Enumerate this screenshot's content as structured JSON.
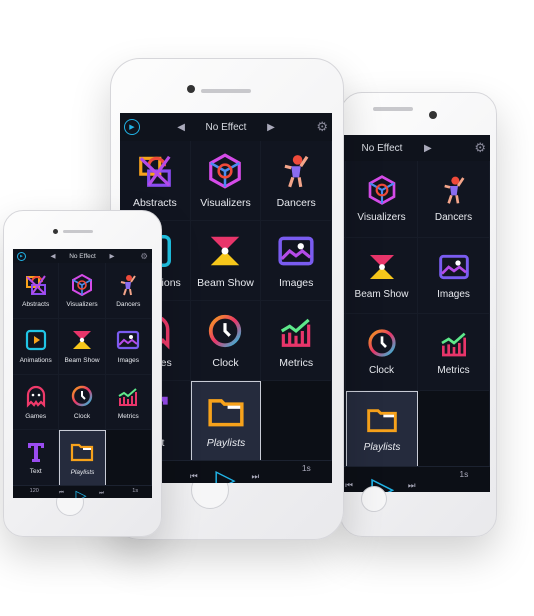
{
  "app": {
    "header": {
      "effect_label": "No Effect",
      "prev_icon": "triangle-left-icon",
      "next_icon": "triangle-right-icon",
      "settings_icon": "gear-icon",
      "logo_icon": "play-circle-logo-icon"
    },
    "categories": [
      {
        "label": "Abstracts",
        "icon": "abstract-shapes-icon"
      },
      {
        "label": "Visualizers",
        "icon": "cube-icon"
      },
      {
        "label": "Dancers",
        "icon": "dancer-icon"
      },
      {
        "label": "Animations",
        "icon": "play-square-icon"
      },
      {
        "label": "Beam Show",
        "icon": "beam-icon"
      },
      {
        "label": "Images",
        "icon": "image-icon"
      },
      {
        "label": "Games",
        "icon": "ghost-icon"
      },
      {
        "label": "Clock",
        "icon": "clock-icon"
      },
      {
        "label": "Metrics",
        "icon": "chart-icon"
      },
      {
        "label": "Text",
        "icon": "text-t-icon"
      },
      {
        "label": "Playlists",
        "icon": "folder-icon",
        "selected": true
      }
    ],
    "bottom_bar": {
      "bpm": "120",
      "duration": "1s",
      "play_icon": "play-icon",
      "prev_icon": "skip-back-icon",
      "next_icon": "skip-forward-icon"
    }
  },
  "colors": {
    "screen_bg": "#0f131c",
    "accent": "#21b3e6",
    "folder": "#f7a21b",
    "selected_tile": "#252b3d"
  }
}
